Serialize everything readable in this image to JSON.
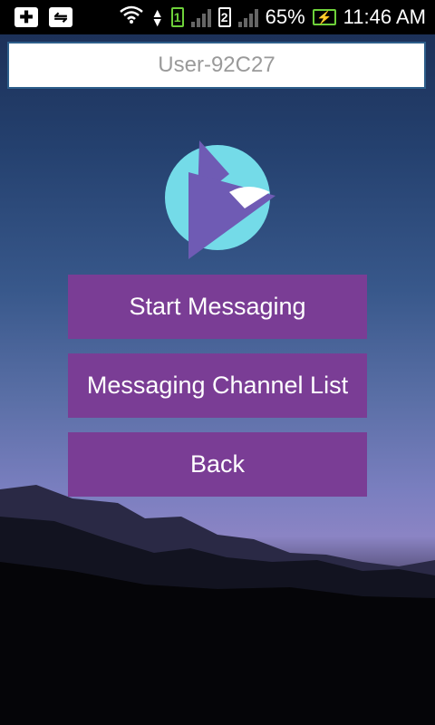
{
  "status_bar": {
    "battery_percent": "65%",
    "time": "11:46 AM",
    "sim1": "1",
    "sim2": "2"
  },
  "user": {
    "id": "User-92C27"
  },
  "buttons": {
    "start": "Start Messaging",
    "list": "Messaging Channel List",
    "back": "Back"
  },
  "colors": {
    "button": "#7a3d95",
    "logo_circle": "#74dbe8",
    "logo_shape": "#6f5bb4"
  }
}
